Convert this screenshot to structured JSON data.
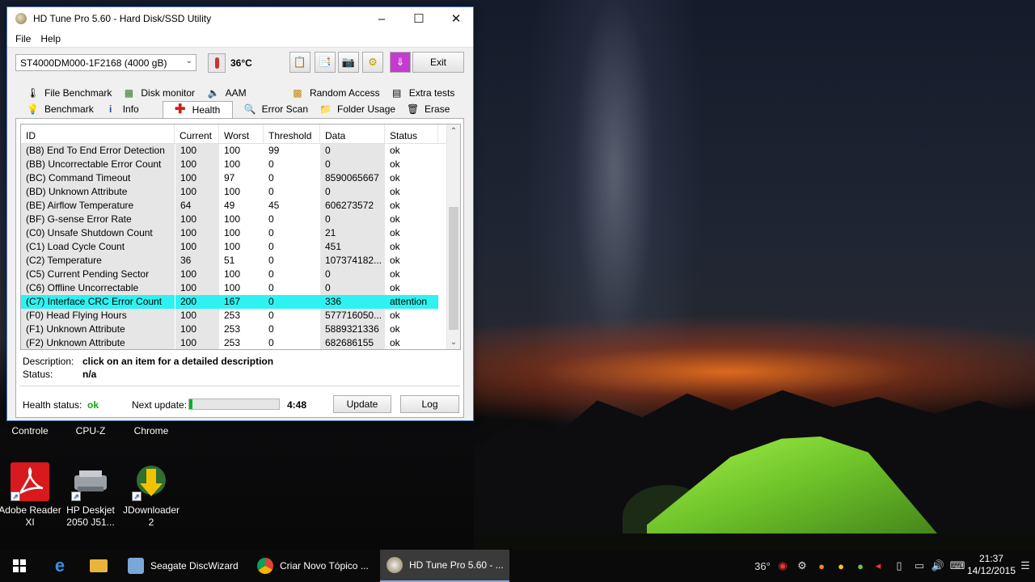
{
  "window": {
    "title": "HD Tune Pro 5.60 - Hard Disk/SSD Utility",
    "menu": [
      "File",
      "Help"
    ],
    "drive": "ST4000DM000-1F2168 (4000 gB)",
    "temperature": "36°C",
    "exit_label": "Exit",
    "tabs_row1": [
      "File Benchmark",
      "Disk monitor",
      "AAM",
      "Random Access",
      "Extra tests"
    ],
    "tabs_row2": [
      "Benchmark",
      "Info",
      "Health",
      "Error Scan",
      "Folder Usage",
      "Erase"
    ],
    "active_tab": "Health"
  },
  "grid": {
    "headers": [
      "ID",
      "Current",
      "Worst",
      "Threshold",
      "Data",
      "Status"
    ],
    "rows": [
      [
        "(B8) End To End Error Detection",
        "100",
        "100",
        "99",
        "0",
        "ok"
      ],
      [
        "(BB) Uncorrectable Error Count",
        "100",
        "100",
        "0",
        "0",
        "ok"
      ],
      [
        "(BC) Command Timeout",
        "100",
        "97",
        "0",
        "8590065667",
        "ok"
      ],
      [
        "(BD) Unknown Attribute",
        "100",
        "100",
        "0",
        "0",
        "ok"
      ],
      [
        "(BE) Airflow Temperature",
        "64",
        "49",
        "45",
        "606273572",
        "ok"
      ],
      [
        "(BF) G-sense Error Rate",
        "100",
        "100",
        "0",
        "0",
        "ok"
      ],
      [
        "(C0) Unsafe Shutdown Count",
        "100",
        "100",
        "0",
        "21",
        "ok"
      ],
      [
        "(C1) Load Cycle Count",
        "100",
        "100",
        "0",
        "451",
        "ok"
      ],
      [
        "(C2) Temperature",
        "36",
        "51",
        "0",
        "107374182...",
        "ok"
      ],
      [
        "(C5) Current Pending Sector",
        "100",
        "100",
        "0",
        "0",
        "ok"
      ],
      [
        "(C6) Offline Uncorrectable",
        "100",
        "100",
        "0",
        "0",
        "ok"
      ],
      [
        "(C7) Interface CRC Error Count",
        "200",
        "167",
        "0",
        "336",
        "attention"
      ],
      [
        "(F0) Head Flying Hours",
        "100",
        "253",
        "0",
        "577716050...",
        "ok"
      ],
      [
        "(F1) Unknown Attribute",
        "100",
        "253",
        "0",
        "5889321336",
        "ok"
      ],
      [
        "(F2) Unknown Attribute",
        "100",
        "253",
        "0",
        "682686155",
        "ok"
      ]
    ],
    "highlight_index": 11,
    "highlight_color": "#2ef2f2"
  },
  "details": {
    "description_label": "Description:",
    "description_value": "click on an item for a detailed description",
    "status_label": "Status:",
    "status_value": "n/a"
  },
  "footer": {
    "health_label": "Health status:",
    "health_value": "ok",
    "health_color": "#16a316",
    "next_update_label": "Next update:",
    "progress_fraction": 0.04,
    "time_left": "4:48",
    "update_label": "Update",
    "log_label": "Log"
  },
  "desktop": {
    "partial_labels": [
      "Controle",
      "CPU-Z",
      "Chrome"
    ],
    "icons": [
      {
        "label": "Adobe Reader XI",
        "icon": "adobe-reader-icon"
      },
      {
        "label": "HP Deskjet 2050 J51...",
        "icon": "printer-icon"
      },
      {
        "label": "JDownloader 2",
        "icon": "jdownloader-icon"
      }
    ]
  },
  "taskbar": {
    "tasks": [
      {
        "label": "Seagate DiscWizard"
      },
      {
        "label": "Criar Novo Tópico ..."
      },
      {
        "label": "HD Tune Pro 5.60 - ..."
      }
    ],
    "tray_temp": "36°",
    "time": "21:37",
    "date": "14/12/2015"
  }
}
